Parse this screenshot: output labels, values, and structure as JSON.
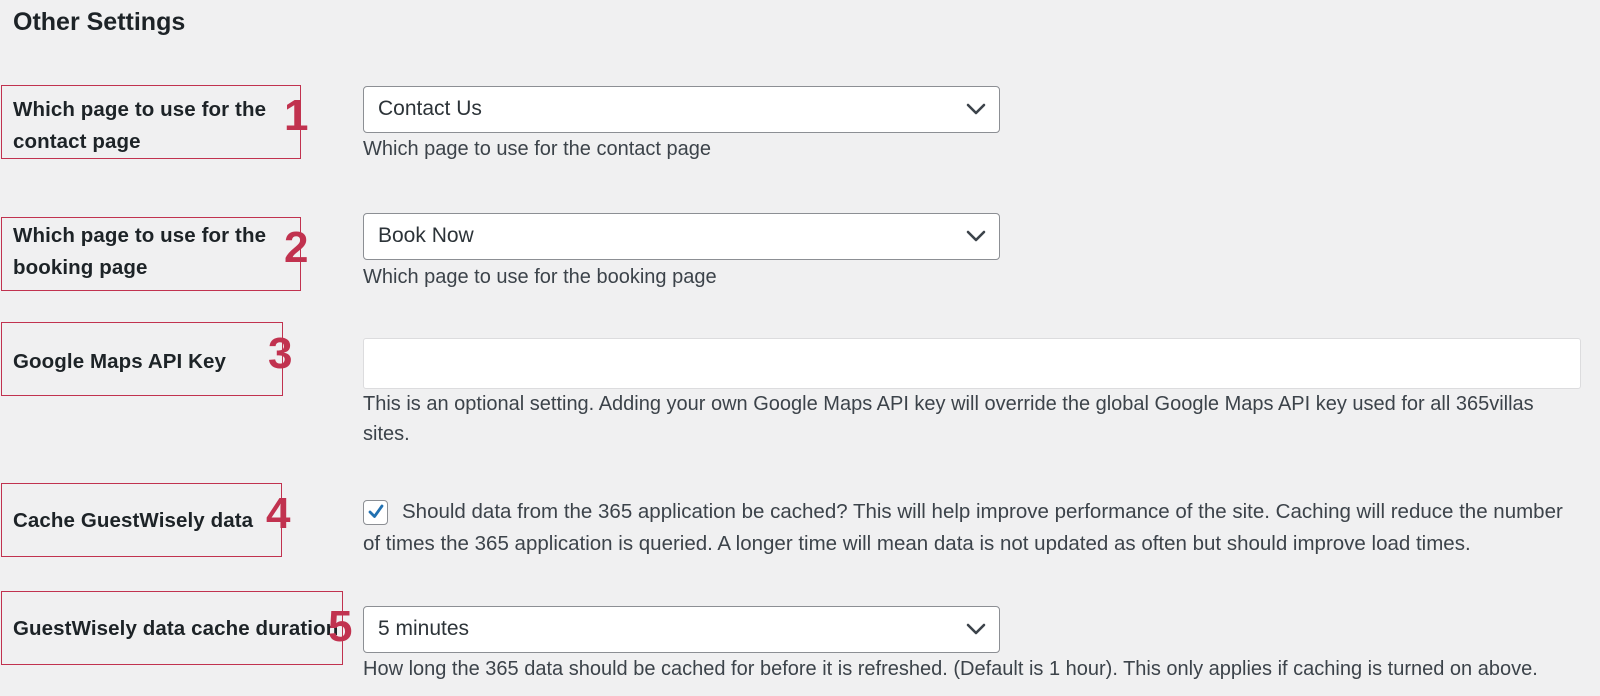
{
  "section": {
    "title": "Other Settings"
  },
  "colors": {
    "annotation": "#c1324f",
    "background": "#f0f0f1",
    "checkbox_accent": "#2271b1"
  },
  "settings": [
    {
      "marker": "1",
      "label_line1": "Which page to use for the",
      "label_line2": "contact page",
      "control": "select",
      "selected": "Contact Us",
      "icon": "chevron-down-icon",
      "description": "Which page to use for the contact page"
    },
    {
      "marker": "2",
      "label_line1": "Which page to use for the",
      "label_line2": "booking page",
      "control": "select",
      "selected": "Book Now",
      "icon": "chevron-down-icon",
      "description": "Which page to use for the booking page"
    },
    {
      "marker": "3",
      "label": "Google Maps API Key",
      "control": "text",
      "value": "",
      "description": "This is an optional setting. Adding your own Google Maps API key will override the global Google Maps API key used for all 365villas sites."
    },
    {
      "marker": "4",
      "label": "Cache GuestWisely data",
      "control": "checkbox",
      "checked": true,
      "icon": "checkmark-icon",
      "description": "Should data from the 365 application be cached? This will help improve performance of the site. Caching will reduce the number of times the 365 application is queried. A longer time will mean data is not updated as often but should improve load times."
    },
    {
      "marker": "5",
      "label": "GuestWisely data cache duration",
      "control": "select",
      "selected": "5 minutes",
      "icon": "chevron-down-icon",
      "description": "How long the 365 data should be cached for before it is refreshed. (Default is 1 hour). This only applies if caching is turned on above."
    }
  ]
}
